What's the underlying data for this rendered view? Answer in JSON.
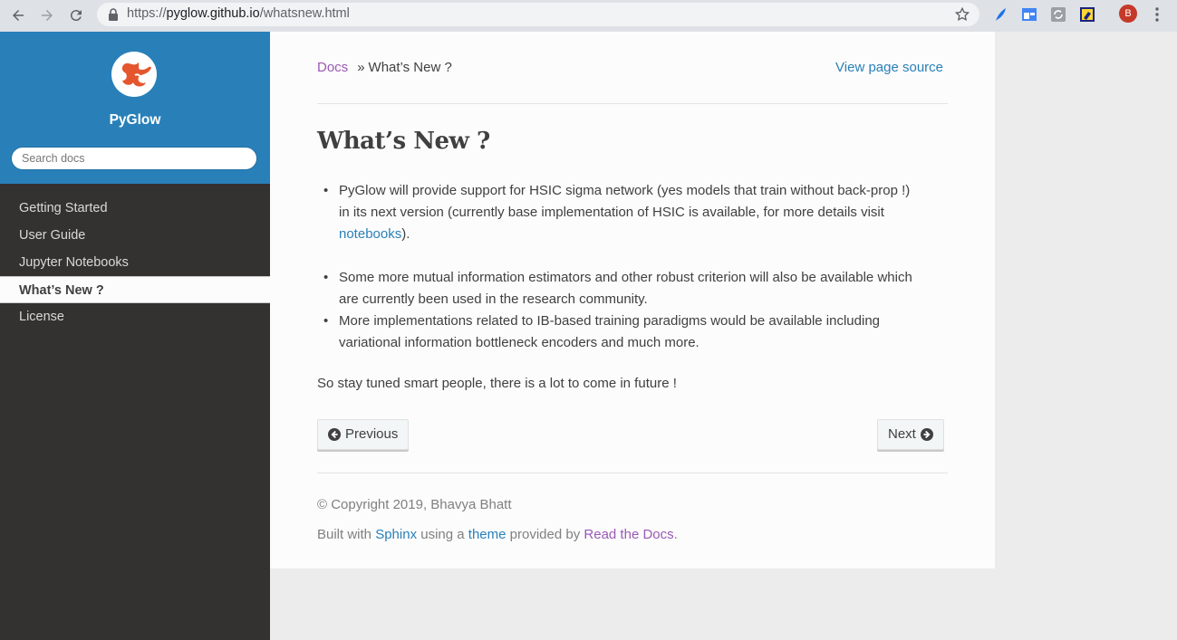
{
  "browser": {
    "url_protocol": "https://",
    "url_host": "pyglow.github.io",
    "url_path": "/whatsnew.html",
    "avatar_letter": "B"
  },
  "sidebar": {
    "project_name": "PyGlow",
    "search_placeholder": "Search docs",
    "items": [
      {
        "label": "Getting Started"
      },
      {
        "label": "User Guide"
      },
      {
        "label": "Jupyter Notebooks"
      },
      {
        "label": "What’s New ?"
      },
      {
        "label": "License"
      }
    ]
  },
  "breadcrumbs": {
    "root": "Docs",
    "separator": "»",
    "current": "What’s New ?",
    "view_source": "View page source"
  },
  "page": {
    "title": "What’s New ?",
    "bullet1_a": "PyGlow will provide support for HSIC sigma network (yes models that train without back-prop !)",
    "bullet1_b": "in its next version (currently base implementation of HSIC is available, for more details visit",
    "bullet1_link": "notebooks",
    "bullet1_end": ").",
    "bullet2_a": "Some more mutual information estimators and other robust criterion will also be available which",
    "bullet2_b": "are currently been used in the research community.",
    "bullet3_a": "More implementations related to IB-based training paradigms would be available including",
    "bullet3_b": "variational information bottleneck encoders and much more.",
    "closing": "So stay tuned smart people, there is a lot to come in future !"
  },
  "pager": {
    "previous": "Previous",
    "next": "Next"
  },
  "footer": {
    "copyright": "© Copyright 2019, Bhavya Bhatt",
    "built_with": "Built with",
    "sphinx": "Sphinx",
    "using_a": "using a",
    "theme": "theme",
    "provided_by": "provided by",
    "rtd": "Read the Docs",
    "period": "."
  },
  "colors": {
    "sidebar_top": "#2980b9",
    "sidebar_bg": "#343131",
    "link_blue": "#2980b9",
    "link_purple": "#9b59b6",
    "logo_orange": "#e4572e"
  }
}
